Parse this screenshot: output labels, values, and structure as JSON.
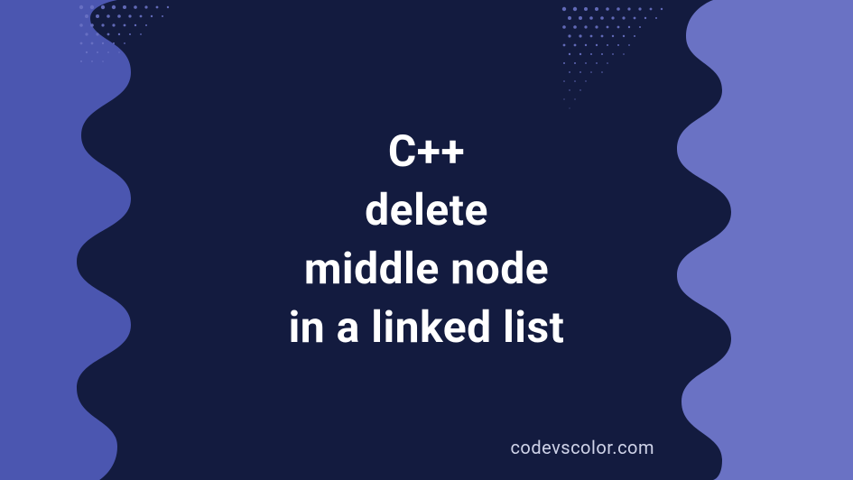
{
  "title": {
    "line1": "C++",
    "line2": "delete",
    "line3": "middle node",
    "line4": "in a linked list"
  },
  "watermark": "codevscolor.com",
  "colors": {
    "bg_left": "#4b56b0",
    "bg_right": "#6a72c4",
    "blob": "#131b3f",
    "text": "#ffffff",
    "watermark": "#cfd3e8"
  }
}
